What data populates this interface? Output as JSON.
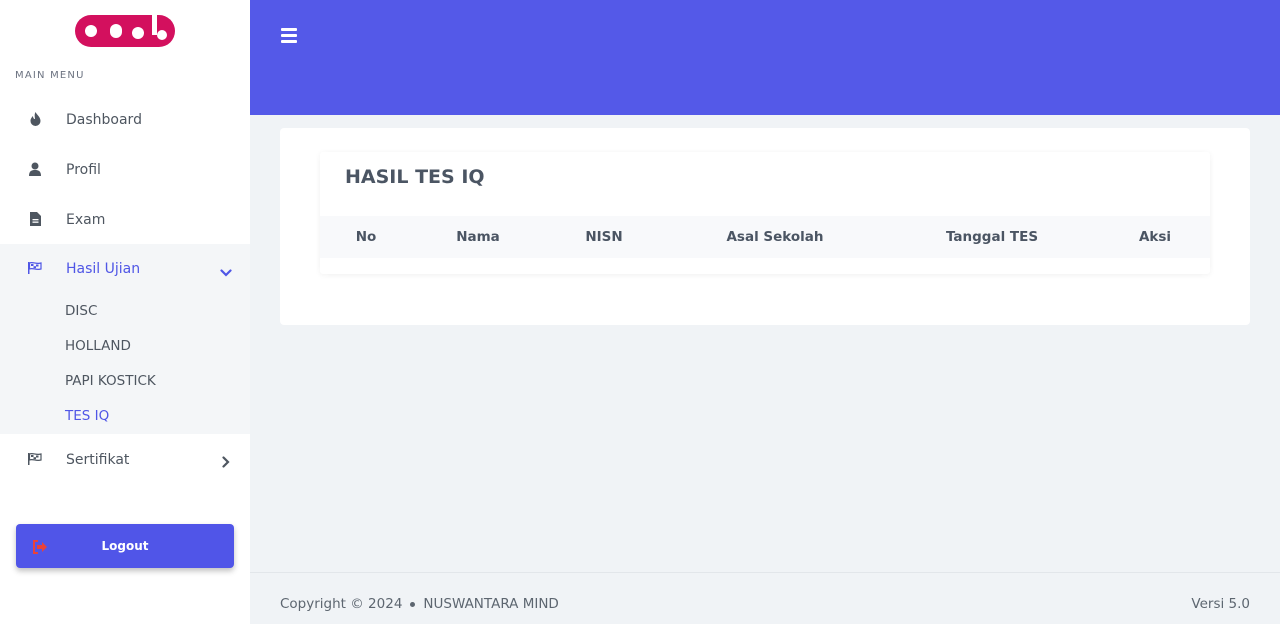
{
  "sidebar": {
    "menu_caption": "MAIN MENU",
    "items": [
      {
        "label": "Dashboard",
        "icon": "fire-icon"
      },
      {
        "label": "Profil",
        "icon": "user-icon"
      },
      {
        "label": "Exam",
        "icon": "file-icon"
      },
      {
        "label": "Hasil Ujian",
        "icon": "flag-checkered-icon",
        "expanded": true
      },
      {
        "label": "Sertifikat",
        "icon": "flag-checkered-icon"
      }
    ],
    "submenu": [
      "DISC",
      "HOLLAND",
      "PAPI KOSTICK",
      "TES IQ"
    ],
    "active_submenu": "TES IQ",
    "logout_label": "Logout"
  },
  "colors": {
    "primary": "#5459e8",
    "brand": "#d3105e",
    "active_text": "#4f56e6",
    "logout_icon": "#e8423b"
  },
  "main": {
    "title": "HASIL TES IQ",
    "columns": [
      "No",
      "Nama",
      "NISN",
      "Asal Sekolah",
      "Tanggal TES",
      "Aksi"
    ]
  },
  "footer": {
    "copyright": "Copyright © 2024",
    "company": "NUSWANTARA MIND",
    "version": "Versi 5.0"
  }
}
